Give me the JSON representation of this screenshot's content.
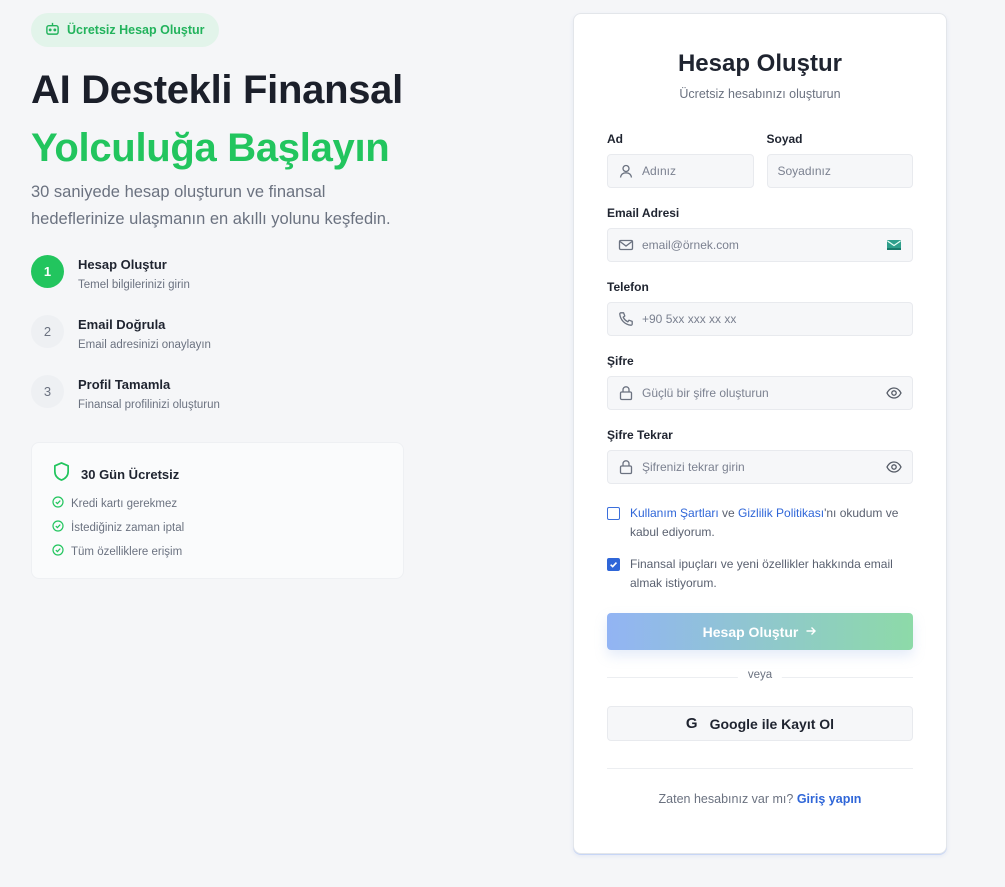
{
  "left": {
    "badge": "Ücretsiz Hesap Oluştur",
    "title_line1": "AI Destekli Finansal",
    "title_line2": "Yolculuğa Başlayın",
    "lead": "30 saniyede hesap oluşturun ve finansal hedeflerinize ulaşmanın en akıllı yolunu keşfedin.",
    "steps": [
      {
        "num": "1",
        "title": "Hesap Oluştur",
        "sub": "Temel bilgilerinizi girin",
        "active": true
      },
      {
        "num": "2",
        "title": "Email Doğrula",
        "sub": "Email adresinizi onaylayın",
        "active": false
      },
      {
        "num": "3",
        "title": "Profil Tamamla",
        "sub": "Finansal profilinizi oluşturun",
        "active": false
      }
    ],
    "trial": {
      "title": "30 Gün Ücretsiz",
      "items": [
        "Kredi kartı gerekmez",
        "İstediğiniz zaman iptal",
        "Tüm özelliklere erişim"
      ]
    }
  },
  "form": {
    "title": "Hesap Oluştur",
    "subtitle": "Ücretsiz hesabınızı oluşturun",
    "first_name": {
      "label": "Ad",
      "placeholder": "Adınız"
    },
    "last_name": {
      "label": "Soyad",
      "placeholder": "Soyadınız"
    },
    "email": {
      "label": "Email Adresi",
      "placeholder": "email@örnek.com"
    },
    "phone": {
      "label": "Telefon",
      "placeholder": "+90 5xx xxx xx xx"
    },
    "password": {
      "label": "Şifre",
      "placeholder": "Güçlü bir şifre oluşturun"
    },
    "password_confirm": {
      "label": "Şifre Tekrar",
      "placeholder": "Şifrenizi tekrar girin"
    },
    "terms": {
      "checked": false,
      "link1": "Kullanım Şartları",
      "and": " ve ",
      "link2": "Gizlilik Politikası",
      "rest": "'nı okudum ve kabul ediyorum."
    },
    "newsletter": {
      "checked": true,
      "text": "Finansal ipuçları ve yeni özellikler hakkında email almak istiyorum."
    },
    "submit_label": "Hesap Oluştur",
    "divider_text": "veya",
    "google_label": "Google ile Kayıt Ol",
    "footer_text": "Zaten hesabınız var mı?",
    "footer_link": "Giriş yapın"
  },
  "colors": {
    "accent_green": "#22c55e",
    "accent_blue": "#2f66d8",
    "background": "#f5f6f8"
  },
  "icons": {
    "badge": "robot-icon",
    "trial": "shield-icon",
    "trial_item": "check-circle-icon",
    "first_name": "user-icon",
    "email": "mail-icon",
    "email_end": "mail-check-icon",
    "phone": "phone-icon",
    "password": "lock-icon",
    "password_end": "eye-icon",
    "submit": "arrow-right-icon",
    "google": "google-icon"
  }
}
